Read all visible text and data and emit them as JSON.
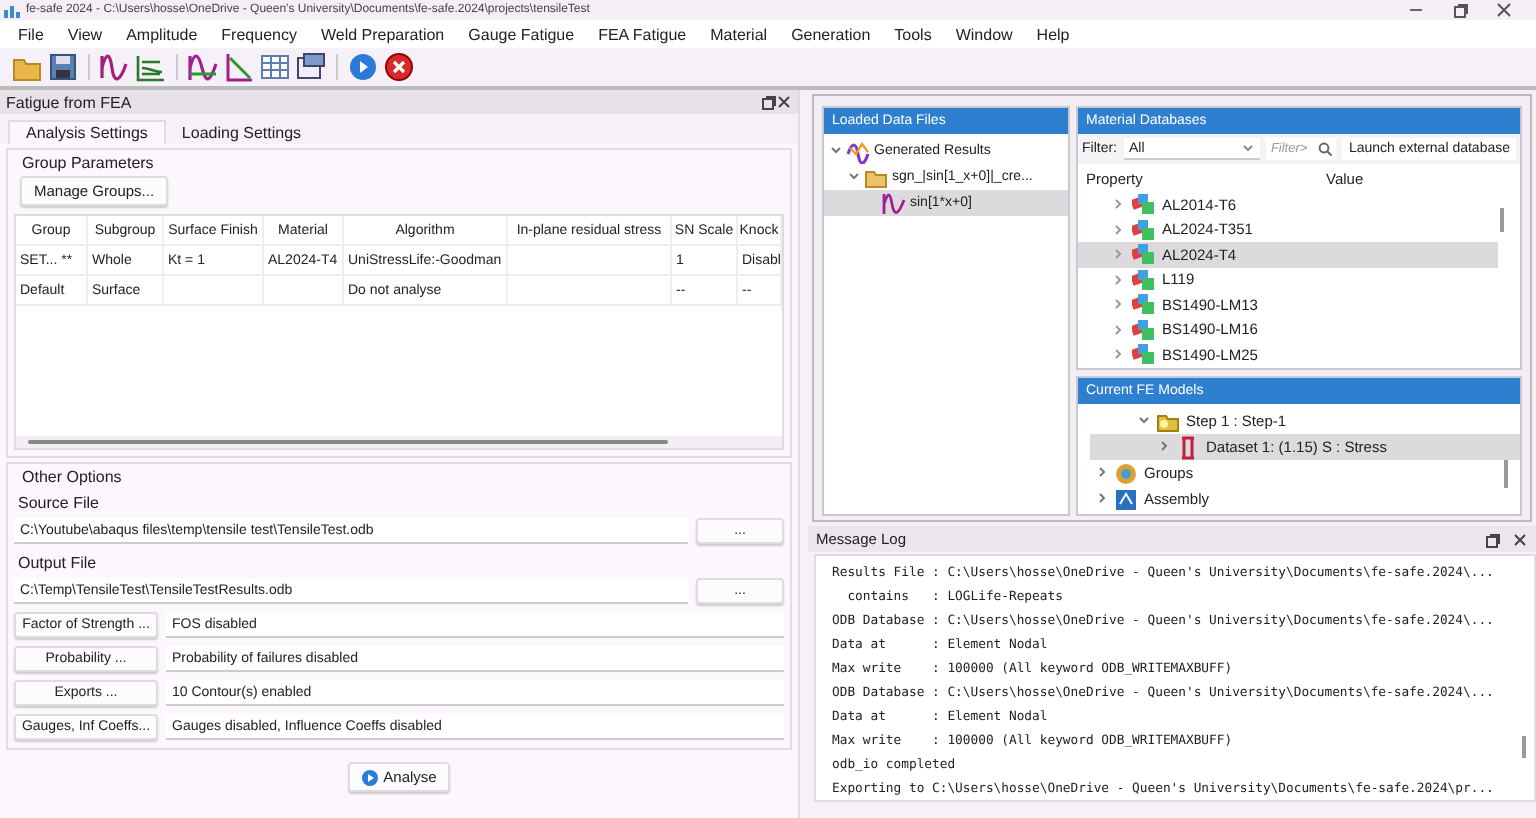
{
  "window": {
    "title": "fe-safe 2024 - C:\\Users\\hosse\\OneDrive - Queen's University\\Documents\\fe-safe.2024\\projects\\tensileTest"
  },
  "menu": [
    "File",
    "View",
    "Amplitude",
    "Frequency",
    "Weld Preparation",
    "Gauge Fatigue",
    "FEA Fatigue",
    "Material",
    "Generation",
    "Tools",
    "Window",
    "Help"
  ],
  "fatigue_panel": {
    "title": "Fatigue from FEA",
    "tabs": [
      {
        "label": "Analysis Settings",
        "selected": true
      },
      {
        "label": "Loading Settings",
        "selected": false
      }
    ],
    "group_parameters": {
      "title": "Group Parameters",
      "manage_button": "Manage Groups...",
      "columns": [
        "Group",
        "Subgroup",
        "Surface Finish",
        "Material",
        "Algorithm",
        "In-plane residual stress",
        "SN Scale",
        "Knock"
      ],
      "rows": [
        [
          "SET... **",
          "Whole",
          "Kt = 1",
          "AL2024-T4",
          "UniStressLife:-Goodman",
          null,
          "1",
          "Disabl"
        ],
        [
          "Default",
          "Surface",
          null,
          null,
          "Do not analyse",
          null,
          "--",
          "--"
        ]
      ]
    },
    "other_options": {
      "title": "Other Options",
      "files": [
        {
          "label": "Source File",
          "value": "C:\\Youtube\\abaqus files\\temp\\tensile test\\TensileTest.odb",
          "browse": "..."
        },
        {
          "label": "Output File",
          "value": "C:\\Temp\\TensileTest\\TensileTestResults.odb",
          "browse": "..."
        }
      ],
      "options": [
        {
          "button": "Factor of Strength ...",
          "value": "FOS disabled"
        },
        {
          "button": "Probability ...",
          "value": "Probability of failures disabled"
        },
        {
          "button": "Exports ...",
          "value": "10 Contour(s) enabled"
        },
        {
          "button": "Gauges, Inf Coeffs...",
          "value": "Gauges disabled, Influence Coeffs disabled"
        }
      ]
    },
    "analyse_button": "Analyse"
  },
  "loaded_data_files": {
    "title": "Loaded Data Files",
    "tree": [
      {
        "label": "Generated Results",
        "kind": "results",
        "expanded": true,
        "selected": false,
        "children": [
          {
            "label": "sgn_|sin[1_x+0]|_cre...",
            "kind": "folder",
            "expanded": true,
            "selected": false,
            "children": [
              {
                "label": "sin[1*x+0]",
                "kind": "signal",
                "selected": true
              }
            ]
          }
        ]
      }
    ]
  },
  "material_databases": {
    "title": "Material Databases",
    "filter_label": "Filter:",
    "filter_value": "All",
    "search_placeholder": "Filter>",
    "launch_button": "Launch external database",
    "columns": [
      "Property",
      "Value"
    ],
    "items": [
      {
        "label": "AL2014-T6",
        "selected": false
      },
      {
        "label": "AL2024-T351",
        "selected": false
      },
      {
        "label": "AL2024-T4",
        "selected": true
      },
      {
        "label": "L119",
        "selected": false
      },
      {
        "label": "BS1490-LM13",
        "selected": false
      },
      {
        "label": "BS1490-LM16",
        "selected": false
      },
      {
        "label": "BS1490-LM25",
        "selected": false
      }
    ]
  },
  "fe_models": {
    "title": "Current FE Models",
    "tree": [
      {
        "label": "Step 1 : Step-1",
        "kind": "step",
        "expanded": true,
        "selected": false,
        "children": [
          {
            "label": "Dataset 1: (1.15) S :  Stress",
            "kind": "dataset",
            "expanded": false,
            "selected": true
          }
        ]
      },
      {
        "label": "Groups",
        "kind": "groups",
        "expanded": false,
        "selected": false
      },
      {
        "label": "Assembly",
        "kind": "assembly",
        "expanded": false,
        "selected": false
      }
    ]
  },
  "message_log": {
    "title": "Message Log",
    "lines": [
      "Results File : C:\\Users\\hosse\\OneDrive - Queen's University\\Documents\\fe-safe.2024\\...",
      "  contains   : LOGLife-Repeats",
      "ODB Database : C:\\Users\\hosse\\OneDrive - Queen's University\\Documents\\fe-safe.2024\\...",
      "Data at      : Element Nodal",
      "Max write    : 100000 (All keyword ODB_WRITEMAXBUFF)",
      "ODB Database : C:\\Users\\hosse\\OneDrive - Queen's University\\Documents\\fe-safe.2024\\...",
      "Data at      : Element Nodal",
      "Max write    : 100000 (All keyword ODB_WRITEMAXBUFF)",
      "odb_io completed",
      "Exporting to C:\\Users\\hosse\\OneDrive - Queen's University\\Documents\\fe-safe.2024\\pr..."
    ]
  }
}
